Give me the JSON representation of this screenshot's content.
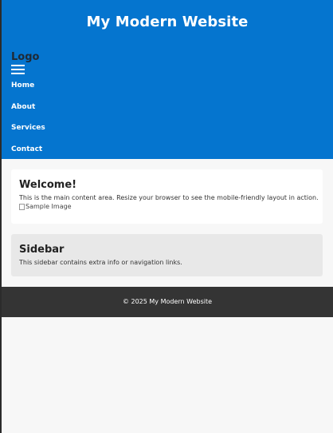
{
  "header": {
    "site_title": "My Modern Website",
    "logo": "Logo",
    "menu_icon": "hamburger-menu-icon",
    "bg_color": "#0575cf"
  },
  "nav": {
    "items": [
      {
        "label": "Home"
      },
      {
        "label": "About"
      },
      {
        "label": "Services"
      },
      {
        "label": "Contact"
      }
    ]
  },
  "main": {
    "heading": "Welcome!",
    "body": "This is the main content area. Resize your browser to see the mobile-friendly layout in action.",
    "image_alt": "Sample Image",
    "image_icon": "broken-image-icon"
  },
  "sidebar": {
    "heading": "Sidebar",
    "body": "This sidebar contains extra info or navigation links.",
    "bg_color": "#e8e8e8"
  },
  "footer": {
    "text": "© 2025 My Modern Website",
    "bg_color": "#343434"
  }
}
